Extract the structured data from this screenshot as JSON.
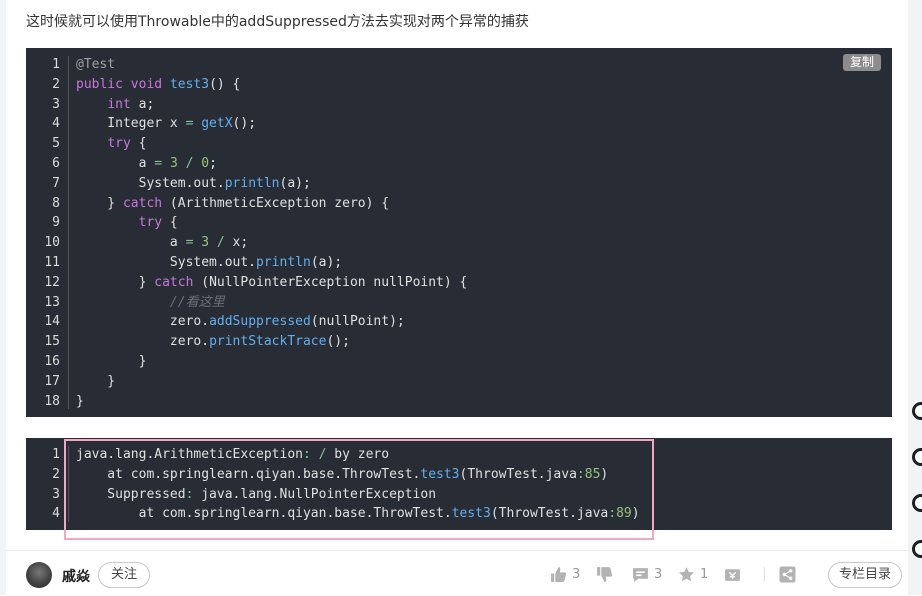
{
  "intro_text": "这时候就可以使用Throwable中的addSuppressed方法去实现对两个异常的捕获",
  "code_block_1": {
    "copy_label": "复制",
    "line_numbers": [
      "1",
      "2",
      "3",
      "4",
      "5",
      "6",
      "7",
      "8",
      "9",
      "10",
      "11",
      "12",
      "13",
      "14",
      "15",
      "16",
      "17",
      "18"
    ],
    "lines": [
      [
        {
          "t": "@Test",
          "c": "anno"
        }
      ],
      [
        {
          "t": "public",
          "c": "kw"
        },
        {
          "t": " ",
          "c": "plain"
        },
        {
          "t": "void",
          "c": "kw"
        },
        {
          "t": " ",
          "c": "plain"
        },
        {
          "t": "test3",
          "c": "fn"
        },
        {
          "t": "() {",
          "c": "plain"
        }
      ],
      [
        {
          "t": "    ",
          "c": "plain"
        },
        {
          "t": "int",
          "c": "kw"
        },
        {
          "t": " a;",
          "c": "plain"
        }
      ],
      [
        {
          "t": "    Integer x ",
          "c": "plain"
        },
        {
          "t": "=",
          "c": "op"
        },
        {
          "t": " ",
          "c": "plain"
        },
        {
          "t": "getX",
          "c": "fn"
        },
        {
          "t": "();",
          "c": "plain"
        }
      ],
      [
        {
          "t": "    ",
          "c": "plain"
        },
        {
          "t": "try",
          "c": "kw"
        },
        {
          "t": " {",
          "c": "plain"
        }
      ],
      [
        {
          "t": "        a ",
          "c": "plain"
        },
        {
          "t": "=",
          "c": "op"
        },
        {
          "t": " ",
          "c": "plain"
        },
        {
          "t": "3",
          "c": "num"
        },
        {
          "t": " ",
          "c": "plain"
        },
        {
          "t": "/",
          "c": "op"
        },
        {
          "t": " ",
          "c": "plain"
        },
        {
          "t": "0",
          "c": "num"
        },
        {
          "t": ";",
          "c": "plain"
        }
      ],
      [
        {
          "t": "        System.out.",
          "c": "plain"
        },
        {
          "t": "println",
          "c": "fn"
        },
        {
          "t": "(a);",
          "c": "plain"
        }
      ],
      [
        {
          "t": "    } ",
          "c": "plain"
        },
        {
          "t": "catch",
          "c": "kw"
        },
        {
          "t": " (ArithmeticException zero) {",
          "c": "plain"
        }
      ],
      [
        {
          "t": "        ",
          "c": "plain"
        },
        {
          "t": "try",
          "c": "kw"
        },
        {
          "t": " {",
          "c": "plain"
        }
      ],
      [
        {
          "t": "            a ",
          "c": "plain"
        },
        {
          "t": "=",
          "c": "op"
        },
        {
          "t": " ",
          "c": "plain"
        },
        {
          "t": "3",
          "c": "num"
        },
        {
          "t": " ",
          "c": "plain"
        },
        {
          "t": "/",
          "c": "op"
        },
        {
          "t": " x;",
          "c": "plain"
        }
      ],
      [
        {
          "t": "            System.out.",
          "c": "plain"
        },
        {
          "t": "println",
          "c": "fn"
        },
        {
          "t": "(a);",
          "c": "plain"
        }
      ],
      [
        {
          "t": "        } ",
          "c": "plain"
        },
        {
          "t": "catch",
          "c": "kw"
        },
        {
          "t": " (NullPointerException nullPoint) {",
          "c": "plain"
        }
      ],
      [
        {
          "t": "            ",
          "c": "plain"
        },
        {
          "t": "//看这里",
          "c": "cm"
        }
      ],
      [
        {
          "t": "            zero.",
          "c": "plain"
        },
        {
          "t": "addSuppressed",
          "c": "fn"
        },
        {
          "t": "(nullPoint);",
          "c": "plain"
        }
      ],
      [
        {
          "t": "            zero.",
          "c": "plain"
        },
        {
          "t": "printStackTrace",
          "c": "fn"
        },
        {
          "t": "();",
          "c": "plain"
        }
      ],
      [
        {
          "t": "        }",
          "c": "plain"
        }
      ],
      [
        {
          "t": "    }",
          "c": "plain"
        }
      ],
      [
        {
          "t": "}",
          "c": "plain"
        }
      ]
    ]
  },
  "code_block_2": {
    "line_numbers": [
      "1",
      "2",
      "3",
      "4"
    ],
    "lines": [
      [
        {
          "t": "java.lang.ArithmeticException",
          "c": "plain"
        },
        {
          "t": ":",
          "c": "op"
        },
        {
          "t": " ",
          "c": "plain"
        },
        {
          "t": "/",
          "c": "op"
        },
        {
          "t": " by zero",
          "c": "plain"
        }
      ],
      [
        {
          "t": "    at com.springlearn.qiyan.base.ThrowTest.",
          "c": "plain"
        },
        {
          "t": "test3",
          "c": "fn"
        },
        {
          "t": "(ThrowTest.java",
          "c": "plain"
        },
        {
          "t": ":",
          "c": "op"
        },
        {
          "t": "85",
          "c": "num"
        },
        {
          "t": ")",
          "c": "plain"
        }
      ],
      [
        {
          "t": "    Suppressed",
          "c": "plain"
        },
        {
          "t": ":",
          "c": "op"
        },
        {
          "t": " java.lang.NullPointerException",
          "c": "plain"
        }
      ],
      [
        {
          "t": "        at com.springlearn.qiyan.base.ThrowTest.",
          "c": "plain"
        },
        {
          "t": "test3",
          "c": "fn"
        },
        {
          "t": "(ThrowTest.java",
          "c": "plain"
        },
        {
          "t": ":",
          "c": "op"
        },
        {
          "t": "89",
          "c": "num"
        },
        {
          "t": ")",
          "c": "plain"
        }
      ]
    ]
  },
  "footer": {
    "author_name": "戚焱",
    "follow_label": "关注",
    "like_count": "3",
    "comment_count": "3",
    "collect_count": "1",
    "catalog_label": "专栏目录"
  }
}
